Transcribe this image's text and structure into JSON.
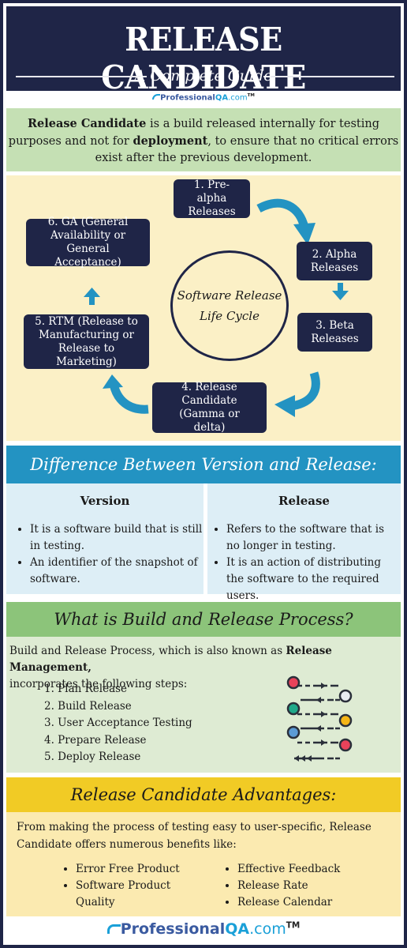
{
  "header": {
    "title": "RELEASE CANDIDATE",
    "subtitle": "A Complete Guide"
  },
  "logo": {
    "part1": "Professional",
    "part2": "QA",
    "part3": ".com",
    "tm": "TM"
  },
  "intro": {
    "bold1": "Release Candidate",
    "text1": " is a build released internally for testing purposes and not for ",
    "bold2": "deployment",
    "text2": ", to ensure that no critical errors exist after the previous development."
  },
  "lifecycle": {
    "center_label_line1": "Software Release",
    "center_label_line2": "Life Cycle",
    "stages": [
      {
        "label": "1. Pre-alpha Releases"
      },
      {
        "label": "2. Alpha Releases"
      },
      {
        "label": "3. Beta Releases"
      },
      {
        "label": "4. Release Candidate (Gamma or delta)"
      },
      {
        "label": "5. RTM (Release to Manufacturing or Release to Marketing)"
      },
      {
        "label": "6. GA (General Availability or General Acceptance)"
      }
    ],
    "arrow_color": "#2393c2",
    "node_color": "#1f2547"
  },
  "difference": {
    "heading": "Difference Between Version and Release:",
    "columns": [
      {
        "title": "Version",
        "items": [
          "It is a software build that is still in testing.",
          "An identifier of the snapshot of software."
        ]
      },
      {
        "title": "Release",
        "items": [
          "Refers to the software that is no longer in testing.",
          "It is an action of distributing the software to the required users."
        ]
      }
    ]
  },
  "build": {
    "heading": "What is Build and Release Process?",
    "intro_text": "Build and Release Process, which is also known as ",
    "intro_bold": "Release Management,",
    "intro_text2": " incorporates the following steps:",
    "steps": [
      "1. Plan Release",
      "2. Build Release",
      "3. User Acceptance Testing",
      "4. Prepare Release",
      "5. Deploy Release"
    ],
    "icon_dot_colors": [
      "#e8425a",
      "#e8ecf2",
      "#1fa98a",
      "#f5b516",
      "#5b9bd5",
      "#e8425a"
    ]
  },
  "advantages": {
    "heading": "Release Candidate Advantages:",
    "intro": "From making the process of testing easy to user-specific, Release Candidate offers numerous benefits like:",
    "left_items": [
      "Error Free Product",
      "Software Product Quality"
    ],
    "right_items": [
      "Effective Feedback",
      "Release Rate",
      "Release Calendar"
    ]
  },
  "colors": {
    "navy": "#1f2547",
    "blue": "#2393c2",
    "green_header": "#8cc47a",
    "yellow_header": "#f1cb25"
  }
}
